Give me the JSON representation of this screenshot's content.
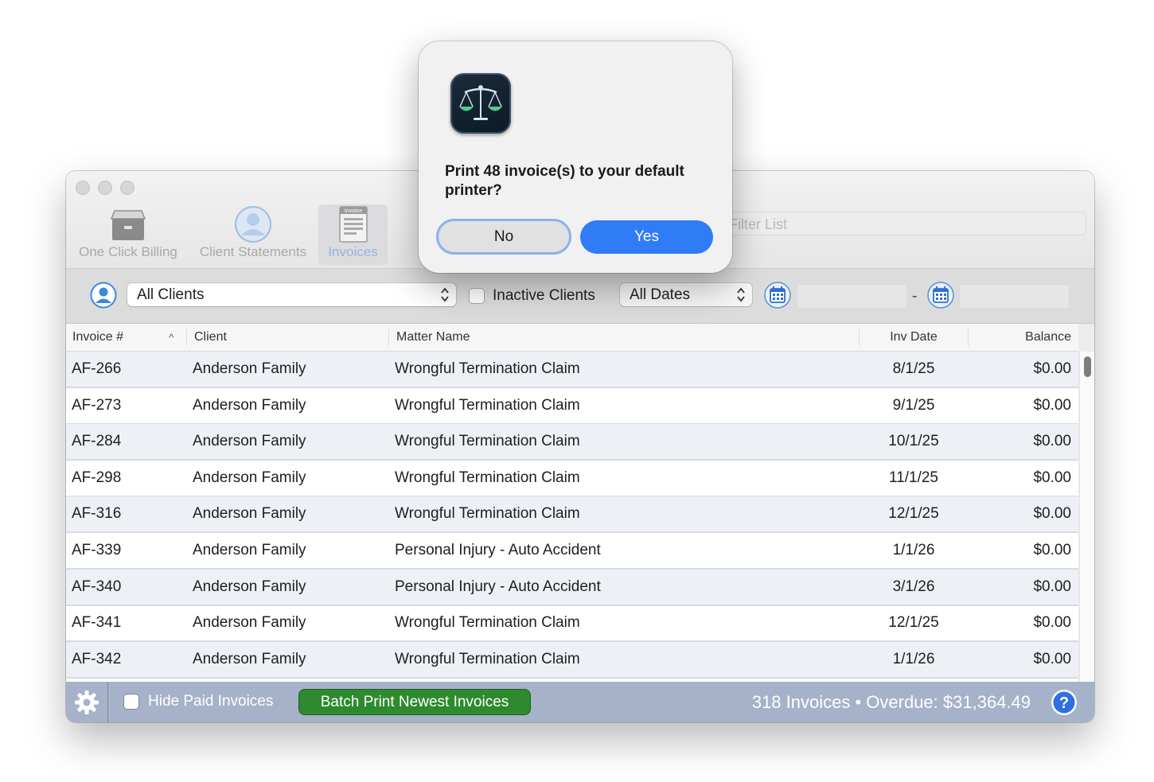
{
  "toolbar": {
    "buttons": [
      {
        "label": "One Click Billing",
        "icon": "archive-box-icon"
      },
      {
        "label": "Client Statements",
        "icon": "person-circle-icon"
      },
      {
        "label": "Invoices",
        "icon": "invoice-document-icon",
        "badge": "Invoice"
      }
    ],
    "filter_placeholder": "Filter List"
  },
  "filters": {
    "client_select": "All Clients",
    "inactive_label": "Inactive Clients",
    "date_select": "All Dates",
    "date_separator": "-"
  },
  "table": {
    "columns": [
      "Invoice #",
      "Client",
      "Matter Name",
      "Inv Date",
      "Balance"
    ],
    "rows": [
      {
        "invoice": "AF-266",
        "client": "Anderson Family",
        "matter": "Wrongful Termination Claim",
        "date": "8/1/25",
        "balance": "$0.00"
      },
      {
        "invoice": "AF-273",
        "client": "Anderson Family",
        "matter": "Wrongful Termination Claim",
        "date": "9/1/25",
        "balance": "$0.00"
      },
      {
        "invoice": "AF-284",
        "client": "Anderson Family",
        "matter": "Wrongful Termination Claim",
        "date": "10/1/25",
        "balance": "$0.00"
      },
      {
        "invoice": "AF-298",
        "client": "Anderson Family",
        "matter": "Wrongful Termination Claim",
        "date": "11/1/25",
        "balance": "$0.00"
      },
      {
        "invoice": "AF-316",
        "client": "Anderson Family",
        "matter": "Wrongful Termination Claim",
        "date": "12/1/25",
        "balance": "$0.00"
      },
      {
        "invoice": "AF-339",
        "client": "Anderson Family",
        "matter": "Personal Injury - Auto Accident",
        "date": "1/1/26",
        "balance": "$0.00"
      },
      {
        "invoice": "AF-340",
        "client": "Anderson Family",
        "matter": "Personal Injury - Auto Accident",
        "date": "3/1/26",
        "balance": "$0.00"
      },
      {
        "invoice": "AF-341",
        "client": "Anderson Family",
        "matter": "Wrongful Termination Claim",
        "date": "12/1/25",
        "balance": "$0.00"
      },
      {
        "invoice": "AF-342",
        "client": "Anderson Family",
        "matter": "Wrongful Termination Claim",
        "date": "1/1/26",
        "balance": "$0.00"
      }
    ]
  },
  "bottom": {
    "hide_paid_label": "Hide Paid Invoices",
    "batch_label": "Batch Print Newest Invoices",
    "status": "318 Invoices • Overdue: $31,364.49"
  },
  "alert": {
    "message": "Print 48 invoice(s) to your default printer?",
    "no_label": "No",
    "yes_label": "Yes"
  },
  "colors": {
    "accent": "#2f7cf6",
    "batch_button": "#2e8a2e",
    "bottom_bar": "#a5b2c9",
    "row_alt": "#edf0f5"
  }
}
